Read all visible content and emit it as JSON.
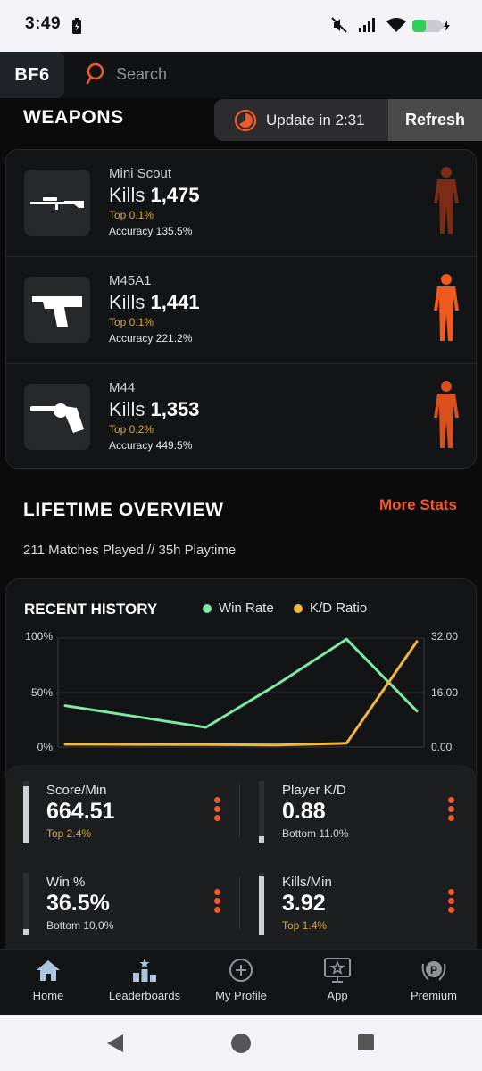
{
  "status_bar": {
    "time": "3:49"
  },
  "header": {
    "logo": "BF6",
    "search_placeholder": "Search"
  },
  "weapons": {
    "title": "WEAPONS",
    "update_text": "Update in 2:31",
    "refresh_label": "Refresh",
    "items": [
      {
        "name": "Mini Scout",
        "kills_label": "Kills",
        "kills": "1,475",
        "top": "Top 0.1%",
        "accuracy": "Accuracy 135.5%",
        "figure_color": "#7a2c14",
        "icon": "sniper-rifle-icon"
      },
      {
        "name": "M45A1",
        "kills_label": "Kills",
        "kills": "1,441",
        "top": "Top 0.1%",
        "accuracy": "Accuracy 221.2%",
        "figure_color": "#f05a1e",
        "icon": "pistol-icon"
      },
      {
        "name": "M44",
        "kills_label": "Kills",
        "kills": "1,353",
        "top": "Top 0.2%",
        "accuracy": "Accuracy 449.5%",
        "figure_color": "#d9501c",
        "icon": "revolver-icon"
      }
    ]
  },
  "lifetime": {
    "title": "LIFETIME OVERVIEW",
    "more_stats": "More Stats",
    "summary": "211 Matches Played // 35h Playtime"
  },
  "recent_history": {
    "title": "RECENT HISTORY",
    "legend": [
      {
        "label": "Win Rate",
        "color": "#7ee8a4"
      },
      {
        "label": "K/D Ratio",
        "color": "#f5b83a"
      }
    ],
    "left_ticks": [
      "100%",
      "50%",
      "0%"
    ],
    "right_ticks": [
      "32.00",
      "16.00",
      "0.00"
    ]
  },
  "chart_data": {
    "type": "line",
    "title": "RECENT HISTORY",
    "x": [
      1,
      2,
      3,
      4,
      5,
      6
    ],
    "series": [
      {
        "name": "Win Rate",
        "axis": "left",
        "values": [
          38,
          28,
          18,
          57,
          99,
          33
        ]
      },
      {
        "name": "K/D Ratio",
        "axis": "right",
        "values": [
          0.8,
          0.75,
          0.7,
          0.6,
          1.1,
          31
        ]
      }
    ],
    "ylim_left": [
      0,
      100
    ],
    "ylim_right": [
      0,
      32
    ],
    "grid": true
  },
  "stats": [
    {
      "name": "Score/Min",
      "value": "664.51",
      "sub": "Top 2.4%",
      "sub_color": "#d3a742",
      "level": 0.92
    },
    {
      "name": "Player K/D",
      "value": "0.88",
      "sub": "Bottom 11.0%",
      "sub_color": "#d6d8db",
      "level": 0.11
    },
    {
      "name": "Win %",
      "value": "36.5%",
      "sub": "Bottom 10.0%",
      "sub_color": "#d6d8db",
      "level": 0.1
    },
    {
      "name": "Kills/Min",
      "value": "3.92",
      "sub": "Top 1.4%",
      "sub_color": "#d3a742",
      "level": 0.95
    }
  ],
  "nav": [
    {
      "label": "Home",
      "icon": "home-icon"
    },
    {
      "label": "Leaderboards",
      "icon": "leaderboard-icon"
    },
    {
      "label": "My Profile",
      "icon": "add-circle-icon"
    },
    {
      "label": "App",
      "icon": "app-star-icon"
    },
    {
      "label": "Premium",
      "icon": "premium-badge-icon"
    }
  ],
  "colors": {
    "accent": "#f05a28"
  }
}
